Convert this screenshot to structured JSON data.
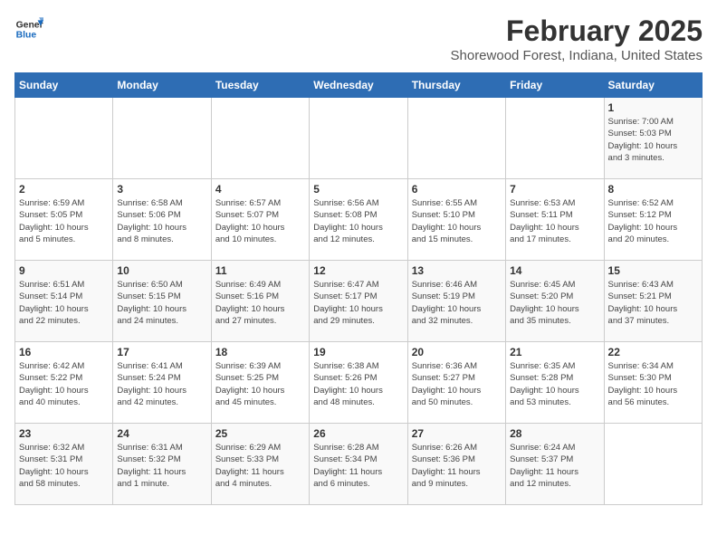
{
  "header": {
    "logo_line1": "General",
    "logo_line2": "Blue",
    "title": "February 2025",
    "subtitle": "Shorewood Forest, Indiana, United States"
  },
  "days_of_week": [
    "Sunday",
    "Monday",
    "Tuesday",
    "Wednesday",
    "Thursday",
    "Friday",
    "Saturday"
  ],
  "weeks": [
    [
      {
        "day": "",
        "info": ""
      },
      {
        "day": "",
        "info": ""
      },
      {
        "day": "",
        "info": ""
      },
      {
        "day": "",
        "info": ""
      },
      {
        "day": "",
        "info": ""
      },
      {
        "day": "",
        "info": ""
      },
      {
        "day": "1",
        "info": "Sunrise: 7:00 AM\nSunset: 5:03 PM\nDaylight: 10 hours\nand 3 minutes."
      }
    ],
    [
      {
        "day": "2",
        "info": "Sunrise: 6:59 AM\nSunset: 5:05 PM\nDaylight: 10 hours\nand 5 minutes."
      },
      {
        "day": "3",
        "info": "Sunrise: 6:58 AM\nSunset: 5:06 PM\nDaylight: 10 hours\nand 8 minutes."
      },
      {
        "day": "4",
        "info": "Sunrise: 6:57 AM\nSunset: 5:07 PM\nDaylight: 10 hours\nand 10 minutes."
      },
      {
        "day": "5",
        "info": "Sunrise: 6:56 AM\nSunset: 5:08 PM\nDaylight: 10 hours\nand 12 minutes."
      },
      {
        "day": "6",
        "info": "Sunrise: 6:55 AM\nSunset: 5:10 PM\nDaylight: 10 hours\nand 15 minutes."
      },
      {
        "day": "7",
        "info": "Sunrise: 6:53 AM\nSunset: 5:11 PM\nDaylight: 10 hours\nand 17 minutes."
      },
      {
        "day": "8",
        "info": "Sunrise: 6:52 AM\nSunset: 5:12 PM\nDaylight: 10 hours\nand 20 minutes."
      }
    ],
    [
      {
        "day": "9",
        "info": "Sunrise: 6:51 AM\nSunset: 5:14 PM\nDaylight: 10 hours\nand 22 minutes."
      },
      {
        "day": "10",
        "info": "Sunrise: 6:50 AM\nSunset: 5:15 PM\nDaylight: 10 hours\nand 24 minutes."
      },
      {
        "day": "11",
        "info": "Sunrise: 6:49 AM\nSunset: 5:16 PM\nDaylight: 10 hours\nand 27 minutes."
      },
      {
        "day": "12",
        "info": "Sunrise: 6:47 AM\nSunset: 5:17 PM\nDaylight: 10 hours\nand 29 minutes."
      },
      {
        "day": "13",
        "info": "Sunrise: 6:46 AM\nSunset: 5:19 PM\nDaylight: 10 hours\nand 32 minutes."
      },
      {
        "day": "14",
        "info": "Sunrise: 6:45 AM\nSunset: 5:20 PM\nDaylight: 10 hours\nand 35 minutes."
      },
      {
        "day": "15",
        "info": "Sunrise: 6:43 AM\nSunset: 5:21 PM\nDaylight: 10 hours\nand 37 minutes."
      }
    ],
    [
      {
        "day": "16",
        "info": "Sunrise: 6:42 AM\nSunset: 5:22 PM\nDaylight: 10 hours\nand 40 minutes."
      },
      {
        "day": "17",
        "info": "Sunrise: 6:41 AM\nSunset: 5:24 PM\nDaylight: 10 hours\nand 42 minutes."
      },
      {
        "day": "18",
        "info": "Sunrise: 6:39 AM\nSunset: 5:25 PM\nDaylight: 10 hours\nand 45 minutes."
      },
      {
        "day": "19",
        "info": "Sunrise: 6:38 AM\nSunset: 5:26 PM\nDaylight: 10 hours\nand 48 minutes."
      },
      {
        "day": "20",
        "info": "Sunrise: 6:36 AM\nSunset: 5:27 PM\nDaylight: 10 hours\nand 50 minutes."
      },
      {
        "day": "21",
        "info": "Sunrise: 6:35 AM\nSunset: 5:28 PM\nDaylight: 10 hours\nand 53 minutes."
      },
      {
        "day": "22",
        "info": "Sunrise: 6:34 AM\nSunset: 5:30 PM\nDaylight: 10 hours\nand 56 minutes."
      }
    ],
    [
      {
        "day": "23",
        "info": "Sunrise: 6:32 AM\nSunset: 5:31 PM\nDaylight: 10 hours\nand 58 minutes."
      },
      {
        "day": "24",
        "info": "Sunrise: 6:31 AM\nSunset: 5:32 PM\nDaylight: 11 hours\nand 1 minute."
      },
      {
        "day": "25",
        "info": "Sunrise: 6:29 AM\nSunset: 5:33 PM\nDaylight: 11 hours\nand 4 minutes."
      },
      {
        "day": "26",
        "info": "Sunrise: 6:28 AM\nSunset: 5:34 PM\nDaylight: 11 hours\nand 6 minutes."
      },
      {
        "day": "27",
        "info": "Sunrise: 6:26 AM\nSunset: 5:36 PM\nDaylight: 11 hours\nand 9 minutes."
      },
      {
        "day": "28",
        "info": "Sunrise: 6:24 AM\nSunset: 5:37 PM\nDaylight: 11 hours\nand 12 minutes."
      },
      {
        "day": "",
        "info": ""
      }
    ]
  ]
}
